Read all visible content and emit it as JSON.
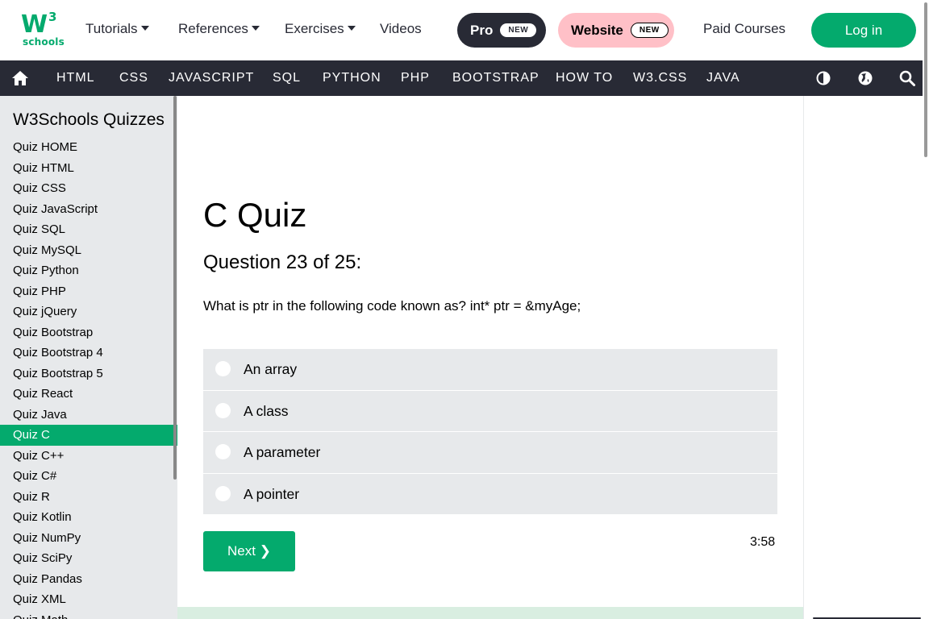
{
  "logo": {
    "mark": "W",
    "superscript": "3",
    "text": "schools"
  },
  "topnav": {
    "tutorials": "Tutorials",
    "references": "References",
    "exercises": "Exercises",
    "videos": "Videos",
    "pro": "Pro",
    "pro_badge": "NEW",
    "website": "Website",
    "website_badge": "NEW",
    "paid_courses": "Paid Courses",
    "login": "Log in"
  },
  "darknav": {
    "items": [
      "HTML",
      "CSS",
      "JAVASCRIPT",
      "SQL",
      "PYTHON",
      "PHP",
      "BOOTSTRAP",
      "HOW TO",
      "W3.CSS",
      "JAVA"
    ],
    "icons": [
      "home-icon",
      "contrast-icon",
      "globe-icon",
      "search-icon"
    ]
  },
  "sidebar": {
    "title": "W3Schools Quizzes",
    "items": [
      "Quiz HOME",
      "Quiz HTML",
      "Quiz CSS",
      "Quiz JavaScript",
      "Quiz SQL",
      "Quiz MySQL",
      "Quiz Python",
      "Quiz PHP",
      "Quiz jQuery",
      "Quiz Bootstrap",
      "Quiz Bootstrap 4",
      "Quiz Bootstrap 5",
      "Quiz React",
      "Quiz Java",
      "Quiz C",
      "Quiz C++",
      "Quiz C#",
      "Quiz R",
      "Quiz Kotlin",
      "Quiz NumPy",
      "Quiz SciPy",
      "Quiz Pandas",
      "Quiz XML",
      "Quiz Math"
    ],
    "active": "Quiz C"
  },
  "quiz": {
    "title": "C Quiz",
    "question_number": "Question 23 of 25:",
    "question": "What is ptr in the following code known as? int* ptr = &myAge;",
    "answers": [
      "An array",
      "A class",
      "A parameter",
      "A pointer"
    ],
    "next": "Next ❯",
    "timer": "3:58"
  },
  "colors": {
    "brand_green": "#04AA6D",
    "dark_nav": "#282A35",
    "sidebar_bg": "#E7E9EB",
    "website_pill": "#FFC0C7"
  }
}
